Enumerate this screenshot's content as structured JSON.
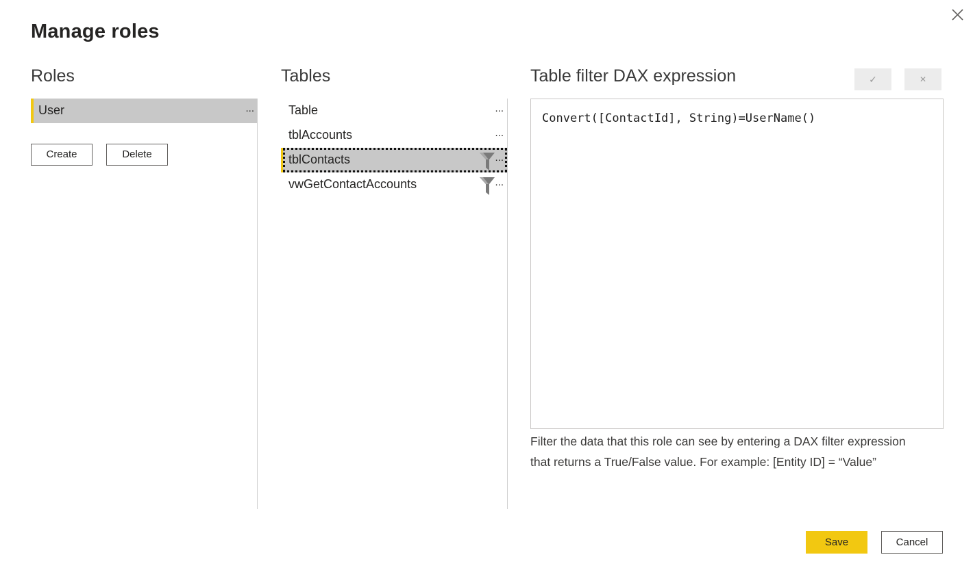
{
  "dialog": {
    "title": "Manage roles",
    "close_icon": "close-icon"
  },
  "roles": {
    "heading": "Roles",
    "items": [
      {
        "label": "User",
        "more": "...",
        "selected": true
      }
    ],
    "create_label": "Create",
    "delete_label": "Delete"
  },
  "tables": {
    "heading": "Tables",
    "items": [
      {
        "label": "Table",
        "more": "...",
        "has_filter": false
      },
      {
        "label": "tblAccounts",
        "more": "...",
        "has_filter": false
      },
      {
        "label": "tblContacts",
        "more": "...",
        "has_filter": true,
        "selected": true
      },
      {
        "label": "vwGetContactAccounts",
        "more": "...",
        "has_filter": true
      }
    ],
    "filter_icon": "filter-icon"
  },
  "dax": {
    "heading": "Table filter DAX expression",
    "confirm_icon": "checkmark-icon",
    "cancel_icon": "close-icon",
    "confirm_glyph": "✓",
    "cancel_glyph": "✕",
    "expression": "Convert([ContactId], String)=UserName()",
    "help_line1": "Filter the data that this role can see by entering a DAX filter expression",
    "help_line2": "that returns a True/False value. For example: [Entity ID] = “Value”"
  },
  "footer": {
    "save_label": "Save",
    "cancel_label": "Cancel"
  },
  "colors": {
    "accent": "#f2c811",
    "selected_background": "#c8c8c8",
    "divider": "#d0d0d0"
  }
}
